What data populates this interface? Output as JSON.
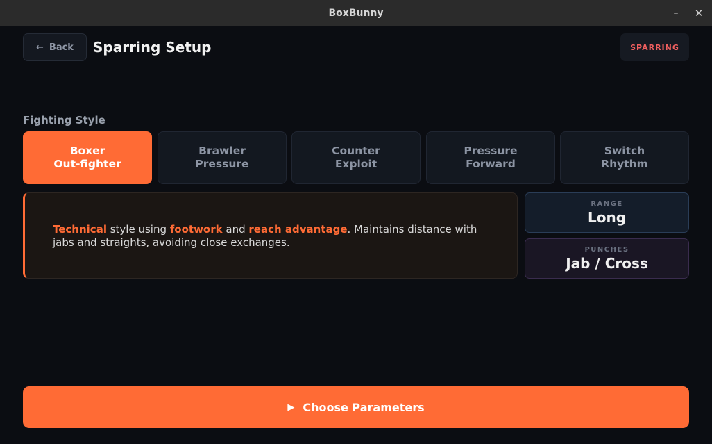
{
  "window": {
    "title": "BoxBunny",
    "minimize_icon": "minimize-icon",
    "close_icon": "close-icon"
  },
  "header": {
    "back_label": "Back",
    "back_arrow": "←",
    "title": "Sparring Setup",
    "mode_badge": "SPARRING"
  },
  "fighting_style": {
    "label": "Fighting Style",
    "options": [
      {
        "line1": "Boxer",
        "line2": "Out-fighter",
        "selected": true
      },
      {
        "line1": "Brawler",
        "line2": "Pressure",
        "selected": false
      },
      {
        "line1": "Counter",
        "line2": "Exploit",
        "selected": false
      },
      {
        "line1": "Pressure",
        "line2": "Forward",
        "selected": false
      },
      {
        "line1": "Switch",
        "line2": "Rhythm",
        "selected": false
      }
    ]
  },
  "description": {
    "w1": "Technical",
    "t1": " style using ",
    "w2": "footwork",
    "t2": " and ",
    "w3": "reach advantage",
    "t3": ". Maintains distance with jabs and straights, avoiding close exchanges."
  },
  "stats": {
    "range_label": "RANGE",
    "range_value": "Long",
    "punches_label": "PUNCHES",
    "punches_value": "Jab / Cross"
  },
  "cta": {
    "icon": "▶",
    "label": "Choose Parameters"
  },
  "colors": {
    "accent": "#ff6b35",
    "background": "#0b0d12",
    "badge_text": "#ef5f5f"
  }
}
